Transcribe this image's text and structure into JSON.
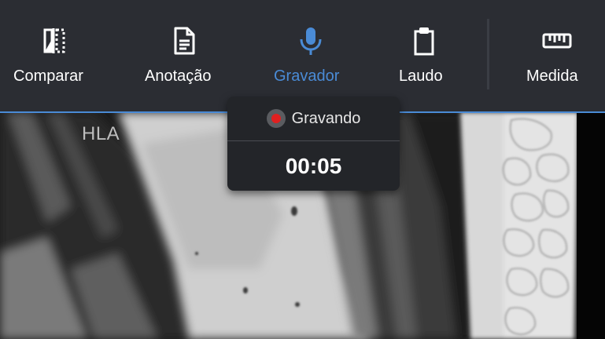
{
  "toolbar": {
    "accent_color": "#4a8bd6",
    "items": [
      {
        "label": "Comparar",
        "icon": "compare-icon",
        "active": false
      },
      {
        "label": "Anotação",
        "icon": "document-icon",
        "active": false
      },
      {
        "label": "Gravador",
        "icon": "microphone-icon",
        "active": true
      },
      {
        "label": "Laudo",
        "icon": "clipboard-icon",
        "active": false
      },
      {
        "label": "Medida",
        "icon": "ruler-icon",
        "active": false
      }
    ]
  },
  "recorder": {
    "status": "Gravando",
    "elapsed": "00:05",
    "indicator_color": "#e02020"
  },
  "viewer": {
    "orientation_label": "HLA"
  }
}
